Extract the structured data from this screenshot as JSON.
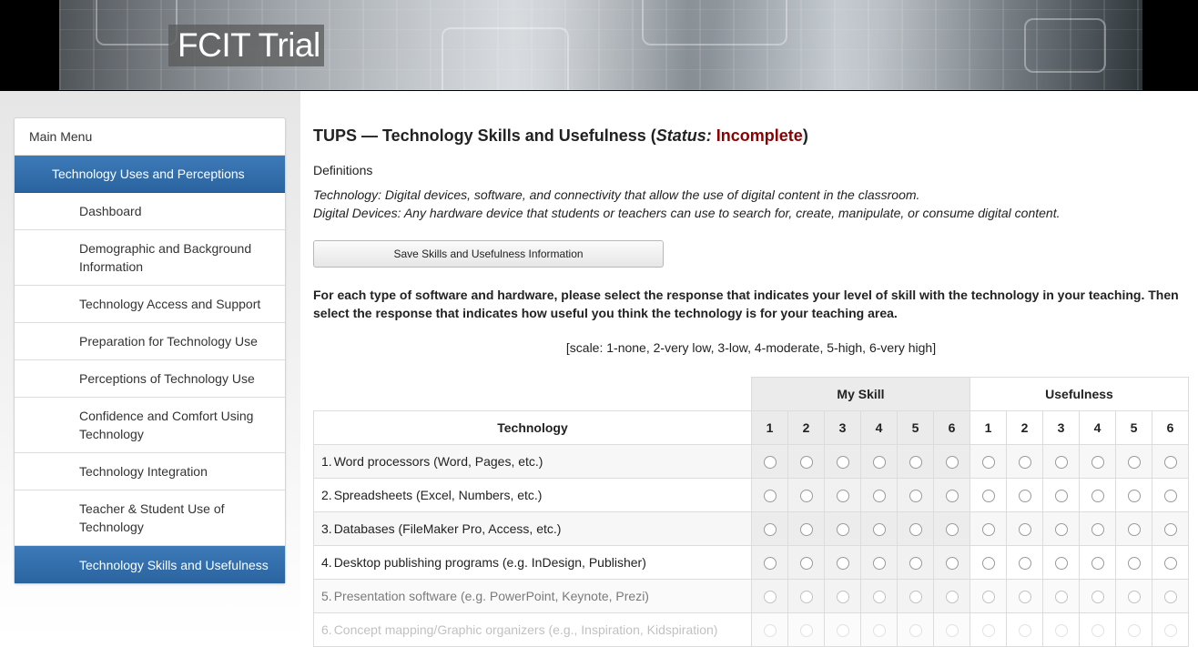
{
  "header": {
    "title": "FCIT Trial"
  },
  "sidebar": {
    "main_menu": "Main Menu",
    "section": "Technology Uses and Perceptions",
    "items": [
      {
        "label": "Dashboard"
      },
      {
        "label": "Demographic and Background Information"
      },
      {
        "label": "Technology Access and Support"
      },
      {
        "label": "Preparation for Technology Use"
      },
      {
        "label": "Perceptions of Technology Use"
      },
      {
        "label": "Confidence and Comfort Using Technology"
      },
      {
        "label": "Technology Integration"
      },
      {
        "label": "Teacher & Student Use of Technology"
      },
      {
        "label": "Technology Skills and Usefulness"
      }
    ]
  },
  "main": {
    "title_prefix": "TUPS — Technology Skills and Usefulness (",
    "status_label": "Status:",
    "status_value": "Incomplete",
    "title_suffix": ")",
    "status_color": "#8b0000",
    "definitions_heading": "Definitions",
    "definitions": [
      "Technology: Digital devices, software, and connectivity that allow the use of digital content in the classroom.",
      "Digital Devices: Any hardware device that students or teachers can use to search for, create, manipulate, or consume digital content."
    ],
    "save_button": "Save Skills and Usefulness Information",
    "instructions": "For each type of software and hardware, please select the response that indicates your level of skill with the technology in your teaching. Then select the response that indicates how useful you think the technology is for your teaching area.",
    "scale": "[scale: 1-none, 2-very low, 3-low, 4-moderate, 5-high, 6-very high]"
  },
  "table": {
    "group_skill": "My Skill",
    "group_usefulness": "Usefulness",
    "technology_header": "Technology",
    "scale_numbers": [
      "1",
      "2",
      "3",
      "4",
      "5",
      "6"
    ],
    "rows": [
      {
        "num": "1.",
        "label": "Word processors (Word, Pages, etc.)"
      },
      {
        "num": "2.",
        "label": "Spreadsheets (Excel, Numbers, etc.)"
      },
      {
        "num": "3.",
        "label": "Databases (FileMaker Pro, Access, etc.)"
      },
      {
        "num": "4.",
        "label": "Desktop publishing programs (e.g. InDesign, Publisher)"
      },
      {
        "num": "5.",
        "label": "Presentation software (e.g. PowerPoint, Keynote, Prezi)"
      },
      {
        "num": "6.",
        "label": "Concept mapping/Graphic organizers (e.g., Inspiration, Kidspiration)"
      }
    ]
  }
}
